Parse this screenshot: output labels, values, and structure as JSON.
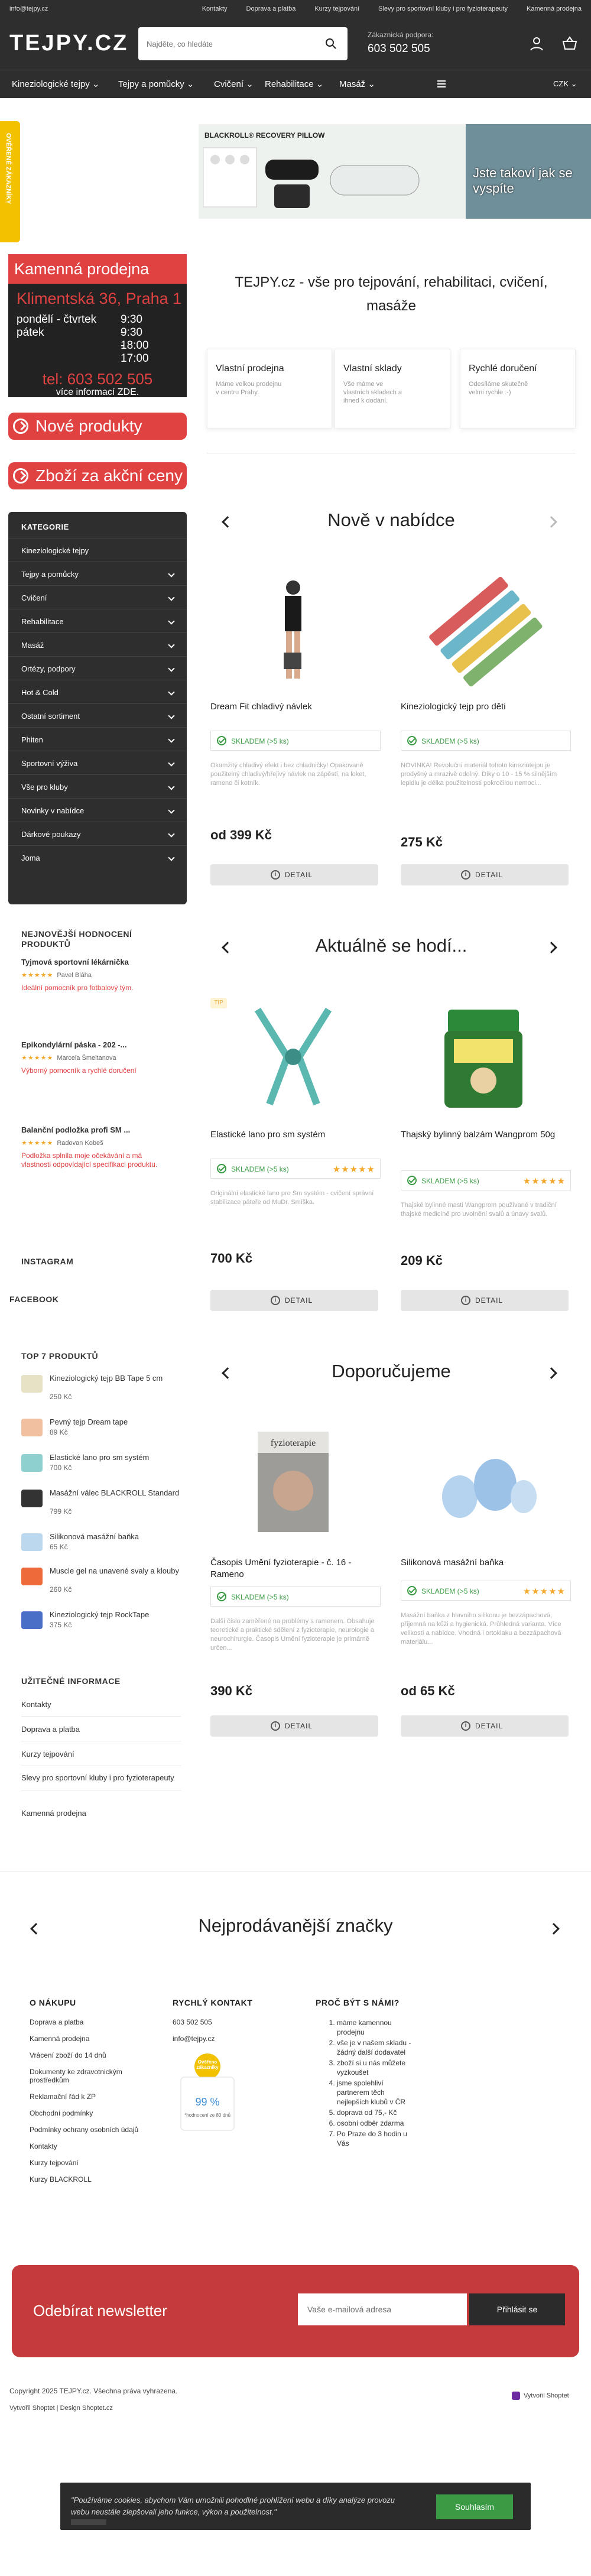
{
  "topbar": {
    "email": "info@tejpy.cz",
    "links": [
      "Kontakty",
      "Doprava a platba",
      "Kurzy tejpování",
      "Slevy pro sportovní kluby i pro fyzioterapeuty",
      "Kamenná prodejna"
    ]
  },
  "header": {
    "logo": "TEJPY.CZ",
    "search_placeholder": "Najděte, co hledáte",
    "support_label": "Zákaznická podpora:",
    "support_phone": "603 502 505",
    "currency": "CZK"
  },
  "nav": [
    "Kineziologické tejpy",
    "Tejpy a pomůcky",
    "Cvičení",
    "Rehabilitace",
    "Masáž"
  ],
  "side_strip": "OVĚŘENÉ ZÁKAZNÍKY",
  "banner": {
    "head": "BLACKROLL® RECOVERY PILLOW",
    "photo_text": "Jste takoví jak se vyspíte"
  },
  "store": {
    "title": "Kamenná prodejna",
    "address": "Klimentská 36, Praha 1",
    "day1": "pondělí - čtvrtek",
    "time1": "9:30 - 18:00",
    "day2": "pátek",
    "time2": "9:30 - 17:00",
    "tel": "tel: 603 502 505",
    "more": "více informací ZDE."
  },
  "buttons": {
    "new": "Nové produkty",
    "sale": "Zboží za akční ceny"
  },
  "categories": {
    "title": "KATEGORIE",
    "items": [
      "Kineziologické tejpy",
      "Tejpy a pomůcky",
      "Cvičení",
      "Rehabilitace",
      "Masáž",
      "Ortézy, podpory",
      "Hot & Cold",
      "Ostatní sortiment",
      "Phiten",
      "Sportovní výživa",
      "Vše pro kluby",
      "Novinky v nabídce",
      "Dárkové poukazy",
      "Joma"
    ]
  },
  "reviews": {
    "title": "NEJNOVĚJŠÍ HODNOCENÍ PRODUKTŮ",
    "items": [
      {
        "t": "Tyjmová sportovní lékárnička",
        "s": "★★★★★",
        "a": "Pavel Bláha",
        "c": "Ideální pomocník pro fotbalový tým."
      },
      {
        "t": "Epikondylární páska - 202 -...",
        "s": "★★★★★",
        "a": "Marcela Šmeltanova",
        "c": "Výborný pomocník a rychlé doručení"
      },
      {
        "t": "Balanční podložka profi SM ...",
        "s": "★★★★★",
        "a": "Radovan Kobeš",
        "c": "Podložka splnila moje očekávání a má vlastnosti odpovídající specifikaci produktu."
      }
    ]
  },
  "social": {
    "instagram": "INSTAGRAM",
    "facebook": "FACEBOOK"
  },
  "top7": {
    "title": "TOP 7 PRODUKTŮ",
    "items": [
      {
        "n": "Kineziologický tejp BB Tape 5 cm",
        "p": "250 Kč",
        "c": "#e7e2c6"
      },
      {
        "n": "Pevný tejp Dream tape",
        "p": "89 Kč",
        "c": "#f0c0a0"
      },
      {
        "n": "Elastické lano pro sm systém",
        "p": "700 Kč",
        "c": "#8ecfcf"
      },
      {
        "n": "Masážní válec BLACKROLL Standard",
        "p": "799 Kč",
        "c": "#333"
      },
      {
        "n": "Silikonová masážní baňka",
        "p": "65 Kč",
        "c": "#bcd8ef"
      },
      {
        "n": "Muscle gel na unavené svaly a klouby",
        "p": "260 Kč",
        "c": "#ef6a3a"
      },
      {
        "n": "Kineziologický tejp RockTape",
        "p": "375 Kč",
        "c": "#4a6fc6"
      }
    ]
  },
  "info": {
    "title": "UŽITEČNÉ INFORMACE",
    "items": [
      "Kontakty",
      "Doprava a platba",
      "Kurzy tejpování",
      "Slevy pro sportovní kluby i pro fyzioterapeuty",
      "Kamenná prodejna"
    ]
  },
  "welcome": "TEJPY.cz - vše pro tejpování, rehabilitaci, cvičení, masáže",
  "features": [
    {
      "t": "Vlastní prodejna",
      "d": "Máme velkou prodejnu v centru Prahy."
    },
    {
      "t": "Vlastní sklady",
      "d": "Vše máme ve vlastních skladech a ihned k dodání."
    },
    {
      "t": "Rychlé doručení",
      "d": "Odesíláme skutečně velmi rychle :-)"
    }
  ],
  "section1": {
    "title": "Nově v nabídce",
    "products": [
      {
        "name": "Dream Fit chladivý návlek",
        "stock": "SKLADEM (>5 ks)",
        "stars": "",
        "desc": "Okamžitý chladivý efekt i bez chladničky! Opakovaně použitelný chladivý/hřejivý návlek na zápěstí, na loket, rameno či kotník.",
        "price": "od 399 Kč",
        "btn": "DETAIL"
      },
      {
        "name": "Kineziologický tejp pro děti",
        "stock": "SKLADEM (>5 ks)",
        "stars": "",
        "desc": "NOVINKA! Revoluční materiál tohoto kineziotejpu je prodyšný a mrazivě odolný. Díky o 10 - 15 % silnějším lepidlu je délka použitelnosti pokročilou nemoci...",
        "price": "275 Kč",
        "btn": "DETAIL"
      }
    ]
  },
  "section2": {
    "title": "Aktuálně se hodí...",
    "tip": "TIP",
    "products": [
      {
        "name": "Elastické lano pro sm systém",
        "stock": "SKLADEM (>5 ks)",
        "stars": "★★★★★",
        "desc": "Originální elastické lano pro Sm systém - cvičení správní stabilizace páteře od MuDr. Smíška.",
        "price": "700 Kč",
        "btn": "DETAIL"
      },
      {
        "name": "Thajský bylinný balzám Wangprom 50g",
        "stock": "SKLADEM (>5 ks)",
        "stars": "★★★★★",
        "desc": "Thajské bylinné masti Wangprom používané v tradiční thajské medicíně pro uvolnění svalů a únavy svalů.",
        "price": "209 Kč",
        "btn": "DETAIL"
      }
    ]
  },
  "section3": {
    "title": "Doporučujeme",
    "products": [
      {
        "name": "Časopis Umění fyzioterapie - č. 16 - Rameno",
        "stock": "SKLADEM (>5 ks)",
        "stars": "",
        "desc": "Další číslo zaměřené na problémy s ramenem. Obsahuje teoretické a praktické sdělení z fyzioterapie, neurologie a neurochirurgie. Časopis Umění fyzioterapie je primárně určen...",
        "price": "390 Kč",
        "btn": "DETAIL"
      },
      {
        "name": "Silikonová masážní baňka",
        "stock": "SKLADEM (>5 ks)",
        "stars": "★★★★★",
        "desc": "Masážní baňka z hlavního silikonu je bezzápachová, příjemná na kůži a hygienická. Průhledná varianta. Více velikostí a nabídce. Vhodná i ortoklaku a bezzápachová materiálu...",
        "price": "od 65 Kč",
        "btn": "DETAIL"
      }
    ]
  },
  "brands": {
    "title": "Nejprodávanější značky"
  },
  "footer": {
    "col1": {
      "title": "O NÁKUPU",
      "items": [
        "Doprava a platba",
        "Kamenná prodejna",
        "Vrácení zboží do 14 dnů",
        "Dokumenty ke zdravotnickým prostředkům",
        "Reklamační řád k ZP",
        "Obchodní podmínky",
        "Podmínky ochrany osobních údajů",
        "Kontakty",
        "Kurzy tejpování",
        "Kurzy BLACKROLL"
      ]
    },
    "col2": {
      "title": "RYCHLÝ KONTAKT",
      "phone": "603 502 505",
      "email": "info@tejpy.cz",
      "badge_pct": "99 %",
      "badge_small": "*hodnocení ze 80 dnů",
      "badge_top": "Ověřeno zákazníky"
    },
    "col3": {
      "title": "PROČ BÝT S NÁMI?",
      "items": [
        "máme kamennou prodejnu",
        "vše je v našem skladu - žádný další dodavatel",
        "zboží si u nás můžete vyzkoušet",
        "jsme spolehliví partnerem těch nejlepších klubů v ČR",
        "doprava od 75,- Kč",
        "osobní odběr zdarma",
        "Po Praze do 3 hodin u Vás"
      ]
    }
  },
  "newsletter": {
    "title": "Odebírat newsletter",
    "placeholder": "Vaše e-mailová adresa",
    "button": "Přihlásit se"
  },
  "copyright": "Copyright 2025 TEJPY.cz. Všechna práva vyhrazena.",
  "made_by": "Vytvořil Shoptet | Design Shoptet.cz",
  "shoptet_logo": "Vytvořil Shoptet",
  "cookie": {
    "text": "\"Používáme cookies, abychom Vám umožnili pohodlné prohlížení webu a díky analýze provozu webu neustále zlepšovali jeho funkce, výkon a použitelnost.\"",
    "button": "Souhlasím"
  }
}
